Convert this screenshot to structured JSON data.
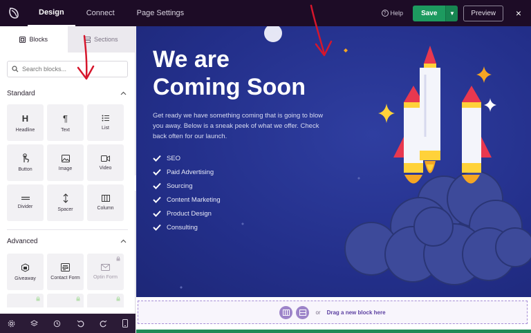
{
  "topbar": {
    "tabs": [
      "Design",
      "Connect",
      "Page Settings"
    ],
    "active_tab": "Design",
    "help_label": "Help",
    "save_label": "Save",
    "preview_label": "Preview",
    "close_symbol": "×"
  },
  "sidebar": {
    "tabs": [
      {
        "label": "Blocks",
        "icon": "blocks-icon"
      },
      {
        "label": "Sections",
        "icon": "sections-icon"
      }
    ],
    "search_placeholder": "Search blocks...",
    "standard_title": "Standard",
    "standard_blocks": [
      {
        "label": "Headline",
        "icon": "headline-icon"
      },
      {
        "label": "Text",
        "icon": "paragraph-icon"
      },
      {
        "label": "List",
        "icon": "list-icon"
      },
      {
        "label": "Button",
        "icon": "button-icon"
      },
      {
        "label": "Image",
        "icon": "image-icon"
      },
      {
        "label": "Video",
        "icon": "video-icon"
      },
      {
        "label": "Divider",
        "icon": "divider-icon"
      },
      {
        "label": "Spacer",
        "icon": "spacer-icon"
      },
      {
        "label": "Column",
        "icon": "column-icon"
      }
    ],
    "advanced_title": "Advanced",
    "advanced_blocks": [
      {
        "label": "Giveaway",
        "icon": "giveaway-icon",
        "locked": false
      },
      {
        "label": "Contact Form",
        "icon": "contact-form-icon",
        "locked": false
      },
      {
        "label": "Optin Form",
        "icon": "optin-form-icon",
        "locked": true
      }
    ]
  },
  "bottombar": {
    "icons": [
      "settings-icon",
      "layers-icon",
      "history-icon",
      "undo-icon",
      "redo-icon",
      "mobile-preview-icon"
    ]
  },
  "canvas": {
    "headline_line1": "We are",
    "headline_line2": "Coming Soon",
    "subtext": "Get ready we have something coming that is going to blow you away. Below is a sneak peek of what we offer. Check back often for our launch.",
    "features": [
      "SEO",
      "Paid Advertising",
      "Sourcing",
      "Content Marketing",
      "Product Design",
      "Consulting"
    ]
  },
  "dropzone": {
    "or_label": "or",
    "drag_label": "Drag a new block here"
  },
  "colors": {
    "topbar_bg": "#1d0c26",
    "save_green": "#1d9a5f",
    "canvas_blue": "#232f8a",
    "arrow_red": "#d6162c",
    "accent_purple": "#5b3fa0"
  }
}
